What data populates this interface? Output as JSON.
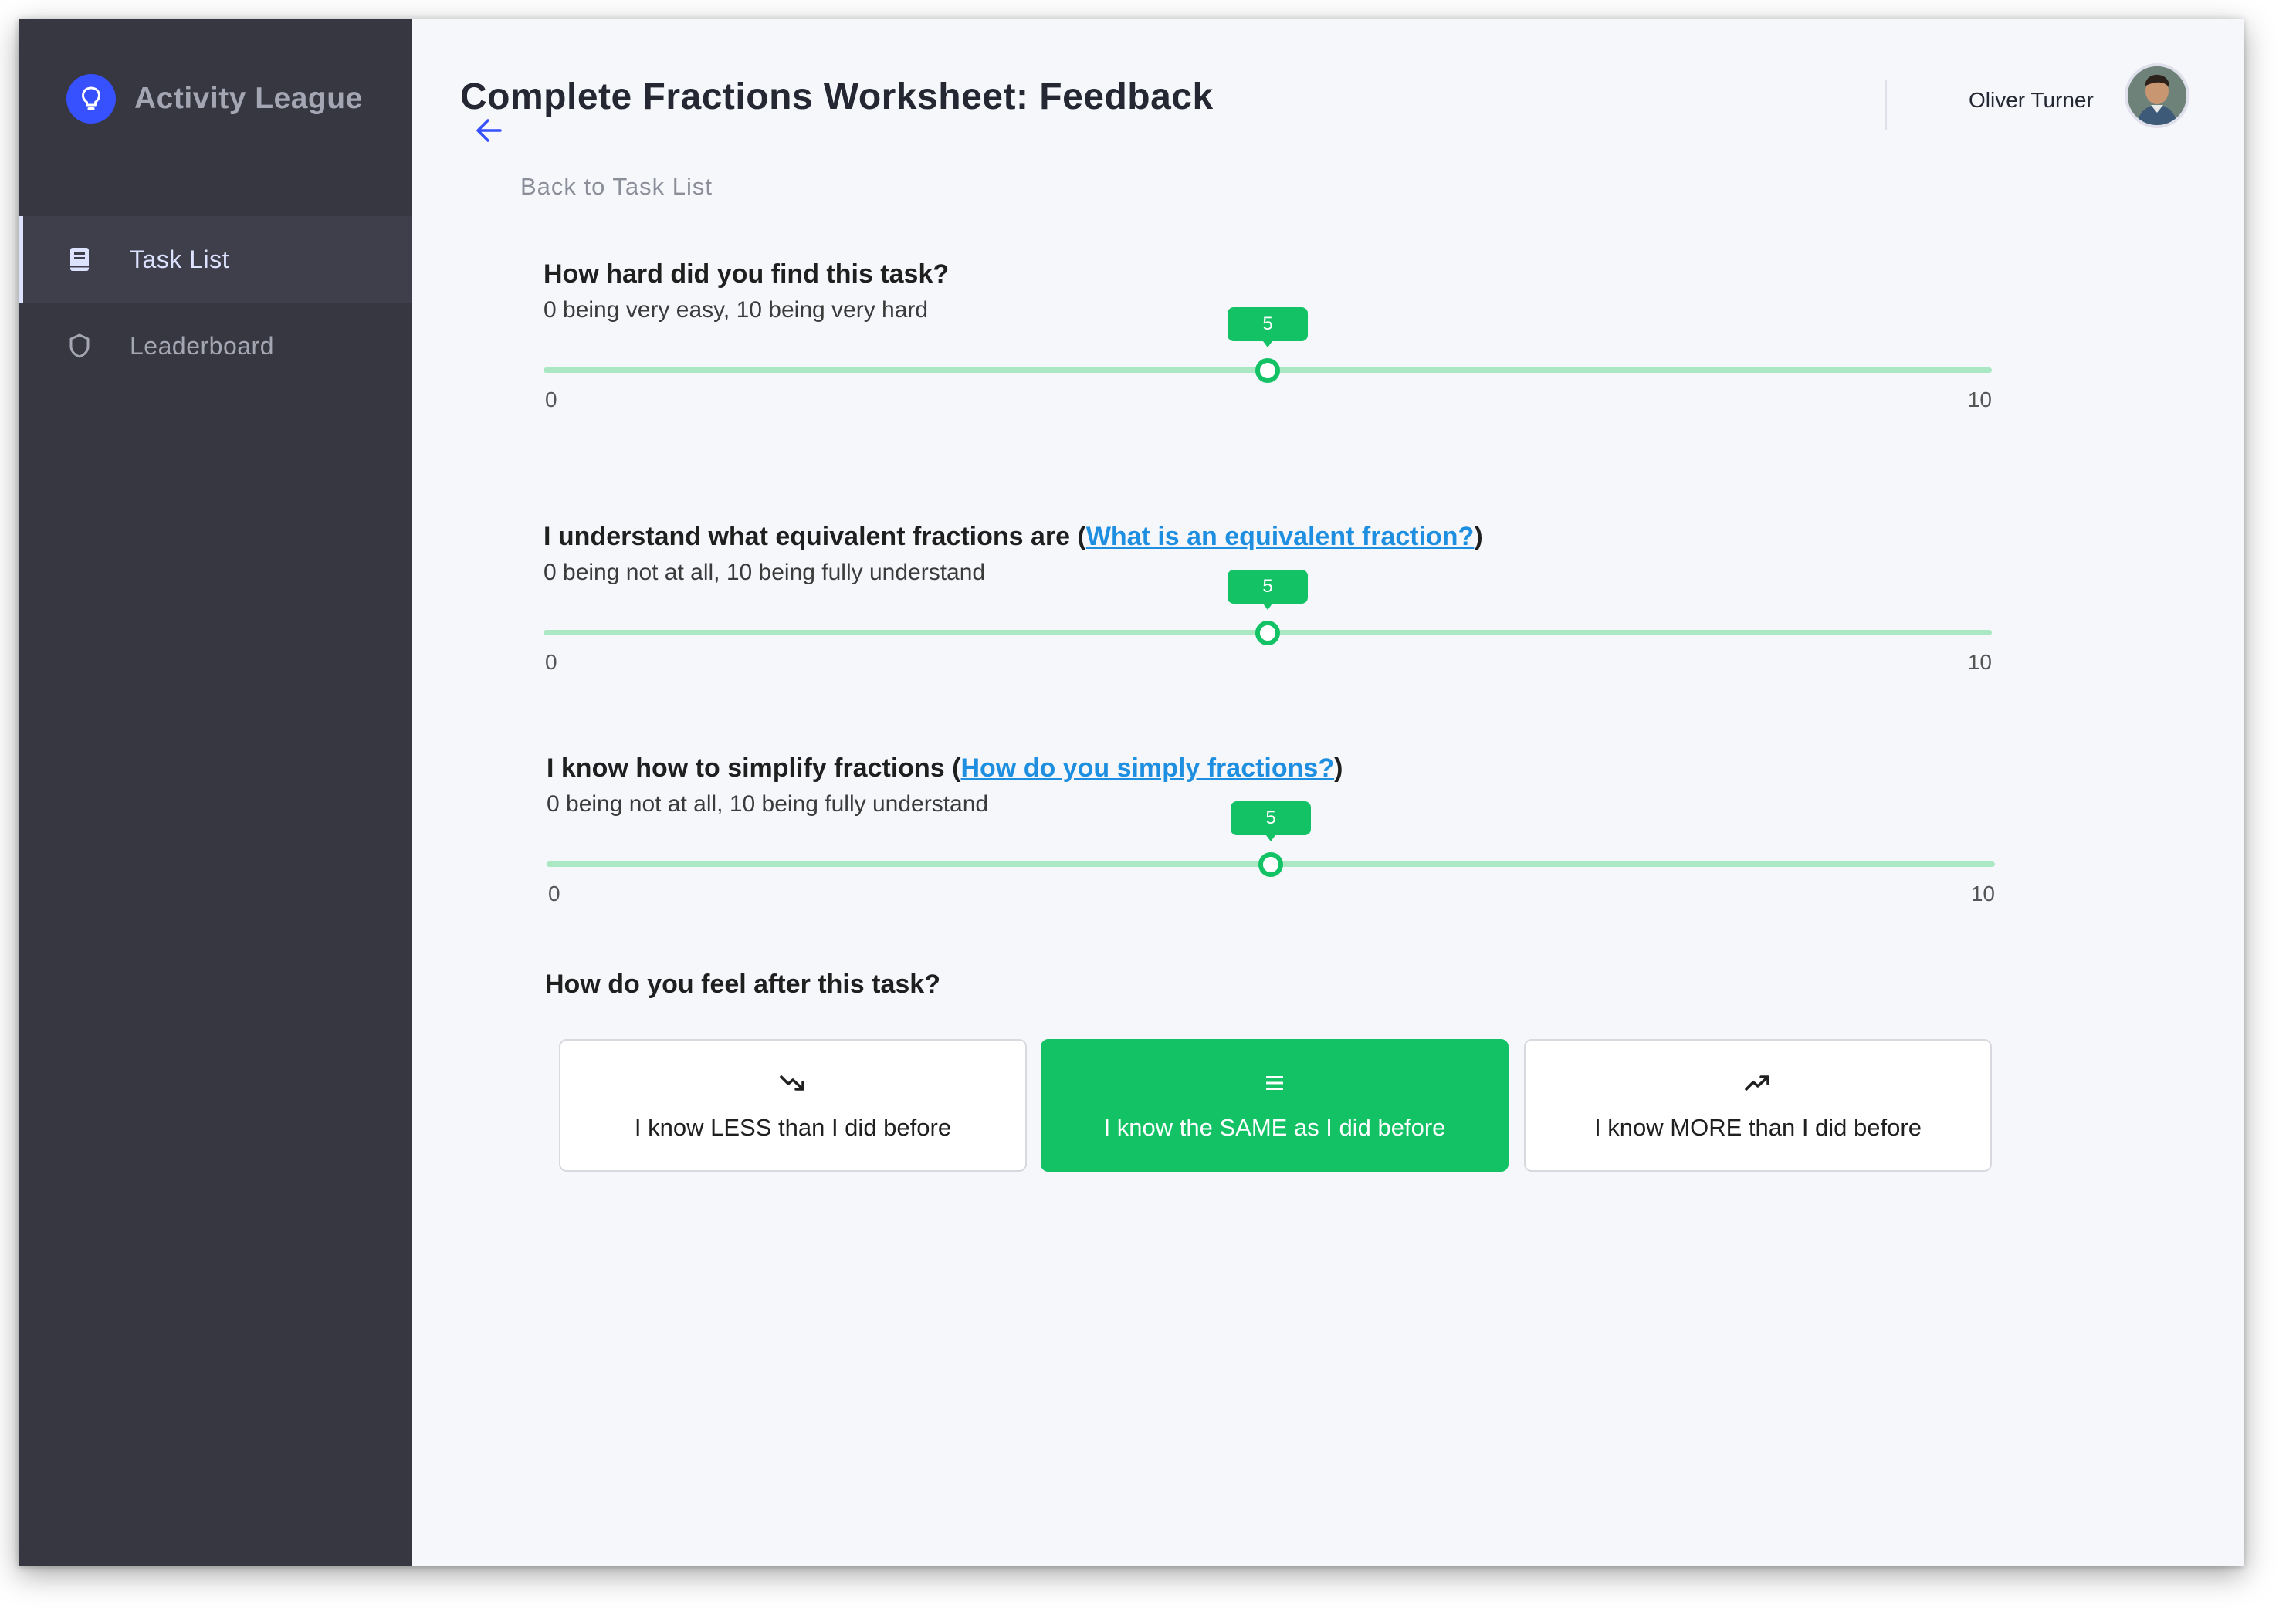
{
  "app": {
    "name": "Activity League",
    "logo_icon": "lightbulb-icon",
    "accent_color": "#3751ff"
  },
  "sidebar": {
    "items": [
      {
        "label": "Task List",
        "icon": "book-icon",
        "active": true
      },
      {
        "label": "Leaderboard",
        "icon": "shield-icon",
        "active": false
      }
    ]
  },
  "header": {
    "title": "Complete Fractions Worksheet: Feedback",
    "back_label": "Back to Task List",
    "user_name": "Oliver Turner"
  },
  "questions": [
    {
      "title": "How hard did you find this task?",
      "link_text": "",
      "title_suffix": "",
      "subtitle": "0 being very easy, 10 being very hard",
      "value": "5",
      "min": "0",
      "max": "10"
    },
    {
      "title": "I understand what equivalent fractions are (",
      "link_text": "What is an equivalent fraction?",
      "title_suffix": ")",
      "subtitle": "0 being not at all, 10 being fully understand",
      "value": "5",
      "min": "0",
      "max": "10"
    },
    {
      "title": "I know how to simplify fractions (",
      "link_text": "How do you simply fractions?",
      "title_suffix": ")",
      "subtitle": "0 being not at all, 10 being fully understand",
      "value": "5",
      "min": "0",
      "max": "10"
    }
  ],
  "feeling": {
    "title": "How do you feel after this task?",
    "options": [
      {
        "label": "I know LESS than I did before",
        "icon": "trending-down-icon",
        "selected": false
      },
      {
        "label": "I know the SAME as I did before",
        "icon": "equals-icon",
        "selected": true
      },
      {
        "label": "I know MORE than I did before",
        "icon": "trending-up-icon",
        "selected": false
      }
    ]
  },
  "colors": {
    "sidebar_bg": "#363740",
    "success": "#12c265",
    "slider_track": "#a9e8c2",
    "link": "#1e8fe0"
  }
}
